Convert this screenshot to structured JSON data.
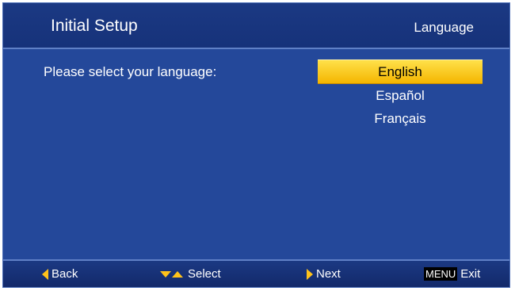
{
  "header": {
    "title": "Initial Setup",
    "section": "Language"
  },
  "prompt": "Please select your language:",
  "languages": [
    {
      "label": "English",
      "selected": true
    },
    {
      "label": "Español",
      "selected": false
    },
    {
      "label": "Français",
      "selected": false
    }
  ],
  "footer": {
    "back": {
      "label": "Back",
      "icon": "arrow-left-icon"
    },
    "select": {
      "label": "Select",
      "icon": "up-down-arrows-icon"
    },
    "next": {
      "label": "Next",
      "icon": "arrow-right-icon"
    },
    "exit": {
      "key": "MENU",
      "label": "Exit"
    }
  },
  "colors": {
    "background": "#24489a",
    "highlight": "#ffd21a",
    "arrow": "#ffc21a"
  }
}
